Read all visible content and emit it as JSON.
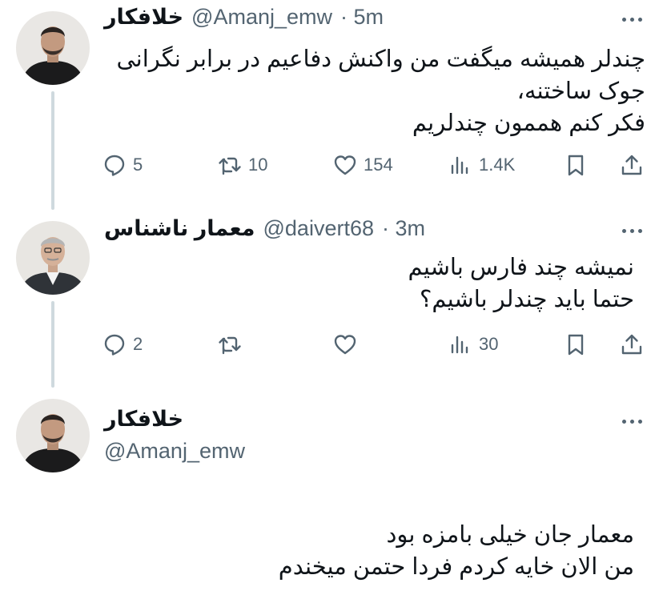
{
  "tweets": [
    {
      "name": "خلافکار",
      "handle": "@Amanj_emw",
      "time": "· 5m",
      "text": [
        "چندلر همیشه میگفت من واکنش دفاعیم در برابر نگرانی",
        "جوک ساختنه،",
        "فکر کنم هممون چندلریم"
      ],
      "actions": {
        "replies": "5",
        "retweets": "10",
        "likes": "154",
        "views": "1.4K"
      }
    },
    {
      "name": "معمار ناشناس",
      "handle": "@daivert68",
      "time": "· 3m",
      "text": [
        "نمیشه چند فارس باشیم",
        "حتما باید چندلر باشیم؟"
      ],
      "actions": {
        "replies": "2",
        "retweets": "",
        "likes": "",
        "views": "30"
      }
    },
    {
      "name": "خلافکار",
      "handle": "@Amanj_emw",
      "text": [
        "معمار جان خیلی بامزه بود",
        "من الان خایه کردم فردا حتمن میخندم"
      ]
    }
  ],
  "colors": {
    "text": "#0f1419",
    "secondary": "#536471",
    "thread_line": "#cfd9de"
  },
  "icons": [
    "reply-icon",
    "retweet-icon",
    "like-icon",
    "views-icon",
    "bookmark-icon",
    "share-icon",
    "more-icon"
  ]
}
